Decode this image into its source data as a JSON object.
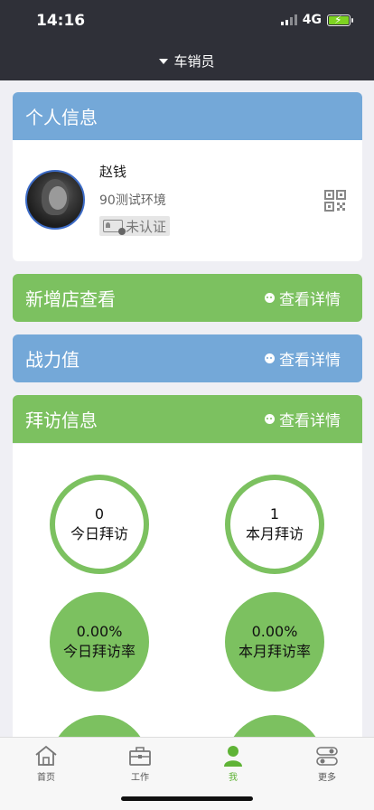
{
  "status_bar": {
    "time": "14:16",
    "network": "4G"
  },
  "nav": {
    "title": "车销员"
  },
  "personal": {
    "header": "个人信息",
    "name": "赵钱",
    "environment": "90测试环境",
    "auth_status": "未认证"
  },
  "new_store": {
    "title": "新增店查看",
    "detail": "查看详情"
  },
  "combat": {
    "title": "战力值",
    "detail": "查看详情"
  },
  "visit": {
    "title": "拜访信息",
    "detail": "查看详情"
  },
  "stats": {
    "today_visits": {
      "value": "0",
      "label": "今日拜访"
    },
    "month_visits": {
      "value": "1",
      "label": "本月拜访"
    },
    "today_rate": {
      "value": "0.00%",
      "label": "今日拜访率"
    },
    "month_rate": {
      "value": "0.00%",
      "label": "本月拜访率"
    }
  },
  "tabs": [
    {
      "label": "首页",
      "icon": "home-icon"
    },
    {
      "label": "工作",
      "icon": "briefcase-icon"
    },
    {
      "label": "我",
      "icon": "person-icon",
      "active": true
    },
    {
      "label": "更多",
      "icon": "toggle-icon"
    }
  ],
  "colors": {
    "header_dark": "#2f3038",
    "blue": "#74a8d8",
    "green": "#7cc160",
    "tab_active": "#5fb336"
  }
}
